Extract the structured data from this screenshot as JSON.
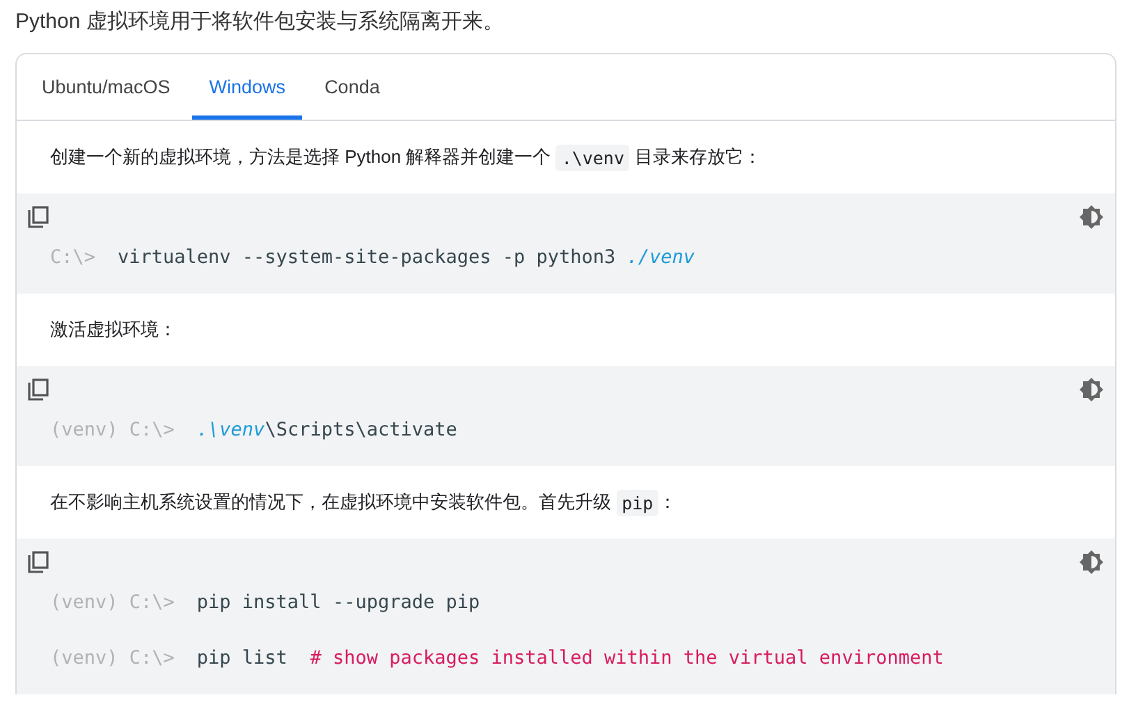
{
  "intro": "Python 虚拟环境用于将软件包安装与系统隔离开来。",
  "tabs": [
    {
      "label": "Ubuntu/macOS",
      "selected": false
    },
    {
      "label": "Windows",
      "selected": true
    },
    {
      "label": "Conda",
      "selected": false
    }
  ],
  "blocks": [
    {
      "kind": "text",
      "segments": [
        {
          "kind": "plain",
          "text": "创建一个新的虚拟环境，方法是选择 Python 解释器并创建一个 "
        },
        {
          "kind": "code",
          "text": ".\\venv"
        },
        {
          "kind": "plain",
          "text": " 目录来存放它："
        }
      ]
    },
    {
      "kind": "code",
      "lines": [
        {
          "prompt": "C:\\>",
          "parts": [
            {
              "kind": "plain",
              "text": "virtualenv --system-site-packages -p python3 "
            },
            {
              "kind": "path",
              "text": "./venv"
            }
          ]
        }
      ]
    },
    {
      "kind": "text",
      "segments": [
        {
          "kind": "plain",
          "text": "激活虚拟环境："
        }
      ]
    },
    {
      "kind": "code",
      "lines": [
        {
          "prompt": "(venv) C:\\>",
          "parts": [
            {
              "kind": "path",
              "text": ".\\venv"
            },
            {
              "kind": "plain",
              "text": "\\Scripts\\activate"
            }
          ]
        }
      ]
    },
    {
      "kind": "text",
      "segments": [
        {
          "kind": "plain",
          "text": "在不影响主机系统设置的情况下，在虚拟环境中安装软件包。首先升级 "
        },
        {
          "kind": "code",
          "text": "pip"
        },
        {
          "kind": "plain",
          "text": "："
        }
      ]
    },
    {
      "kind": "code",
      "lines": [
        {
          "prompt": "(venv) C:\\>",
          "parts": [
            {
              "kind": "plain",
              "text": "pip install --upgrade pip"
            }
          ]
        },
        {
          "prompt": "(venv) C:\\>",
          "parts": [
            {
              "kind": "plain",
              "text": "pip list  "
            },
            {
              "kind": "comment",
              "text": "# show packages installed within the virtual environment"
            }
          ]
        }
      ]
    }
  ]
}
